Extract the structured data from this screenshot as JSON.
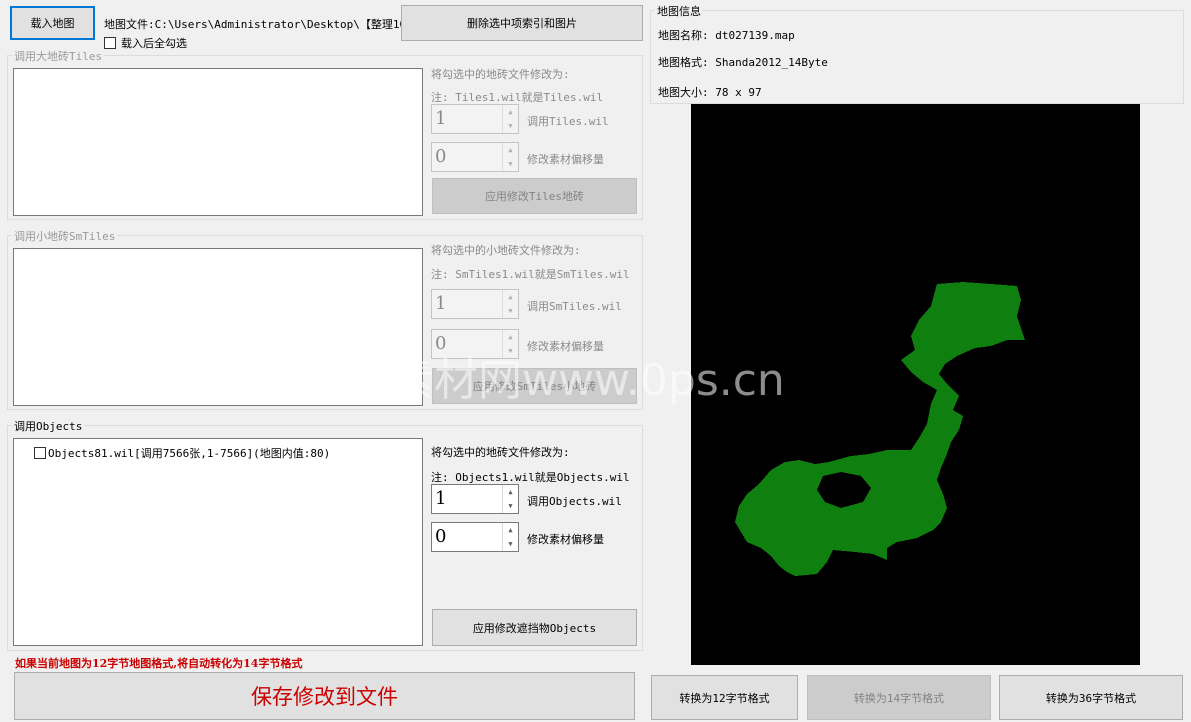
{
  "top": {
    "load_map_label": "载入地图",
    "map_file_text": "地图文件:C:\\Users\\Administrator\\Desktop\\【整理10】",
    "select_all_after_load_label": "载入后全勾选",
    "delete_selected_label": "删除选中项索引和图片"
  },
  "tiles_group": {
    "title": "调用大地砖Tiles",
    "change_label": "将勾选中的地砖文件修改为:",
    "note": "注: Tiles1.wil就是Tiles.wil",
    "spin1_value": "1",
    "spin1_label": "调用Tiles.wil",
    "spin2_value": "0",
    "spin2_label": "修改素材偏移量",
    "apply_label": "应用修改Tiles地砖"
  },
  "smtiles_group": {
    "title": "调用小地砖SmTiles",
    "change_label": "将勾选中的小地砖文件修改为:",
    "note": "注: SmTiles1.wil就是SmTiles.wil",
    "spin1_value": "1",
    "spin1_label": "调用SmTiles.wil",
    "spin2_value": "0",
    "spin2_label": "修改素材偏移量",
    "apply_label": "应用修改SmTiles小地砖"
  },
  "objects_group": {
    "title": "调用Objects",
    "items": [
      {
        "label": "Objects81.wil[调用7566张,1-7566](地图内值:80)",
        "checked": false
      }
    ],
    "change_label": "将勾选中的地砖文件修改为:",
    "note": "注: Objects1.wil就是Objects.wil",
    "spin1_value": "1",
    "spin1_label": "调用Objects.wil",
    "spin2_value": "0",
    "spin2_label": "修改素材偏移量",
    "apply_label": "应用修改遮挡物Objects"
  },
  "warning_text": "如果当前地图为12字节地图格式,将自动转化为14字节格式",
  "save_label": "保存修改到文件",
  "map_info": {
    "title": "地图信息",
    "name_label": "地图名称:",
    "name_value": "dt027139.map",
    "format_label": "地图格式:",
    "format_value": "Shanda2012_14Byte",
    "size_label": "地图大小:",
    "size_value": "78 x 97"
  },
  "convert": {
    "to12_label": "转换为12字节格式",
    "to14_label": "转换为14字节格式",
    "to36_label": "转换为36字节格式"
  },
  "watermark_text": "素材网www.0ps.cn",
  "colors": {
    "map_background": "#000000",
    "map_land": "#0f7f0f",
    "warning": "#cc0000",
    "save_text": "#cc0000",
    "focus_border": "#0078d7"
  }
}
